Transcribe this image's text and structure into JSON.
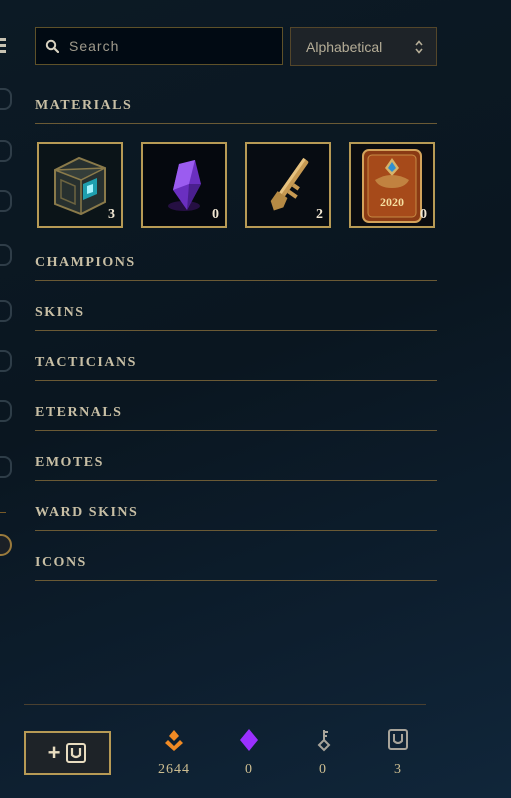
{
  "search": {
    "placeholder": "Search",
    "value": ""
  },
  "sort": {
    "selected": "Alphabetical"
  },
  "sections": [
    {
      "id": "materials",
      "label": "MATERIALS"
    },
    {
      "id": "champions",
      "label": "CHAMPIONS"
    },
    {
      "id": "skins",
      "label": "SKINS"
    },
    {
      "id": "tacticians",
      "label": "TACTICIANS"
    },
    {
      "id": "eternals",
      "label": "ETERNALS"
    },
    {
      "id": "emotes",
      "label": "EMOTES"
    },
    {
      "id": "ward-skins",
      "label": "WARD SKINS"
    },
    {
      "id": "icons",
      "label": "ICONS"
    }
  ],
  "materials": [
    {
      "icon": "hextech-chest-icon",
      "count": "3"
    },
    {
      "icon": "mythic-essence-crystal-icon",
      "count": "0"
    },
    {
      "icon": "key-fragment-icon",
      "count": "2"
    },
    {
      "icon": "event-card-icon",
      "count": "0",
      "card_year": "2020"
    }
  ],
  "footer": {
    "currencies": [
      {
        "icon": "orange-essence-icon",
        "value": "2644"
      },
      {
        "icon": "mythic-essence-icon",
        "value": "0"
      },
      {
        "icon": "key-icon",
        "value": "0"
      },
      {
        "icon": "chest-icon",
        "value": "3"
      }
    ],
    "craft_button": {
      "plus": "+"
    }
  },
  "colors": {
    "gold": "#c8aa6e",
    "border": "#785a28",
    "bg": "#0a1620",
    "mythic": "#9b30ff",
    "essence": "#f08a24"
  }
}
